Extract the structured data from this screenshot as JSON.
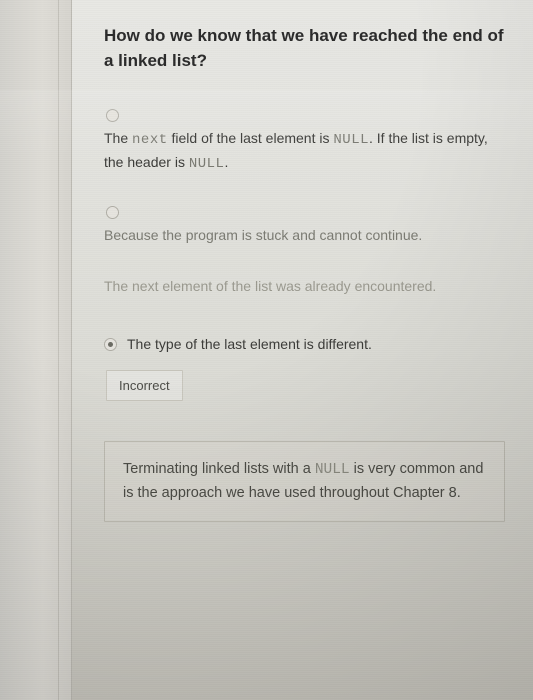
{
  "question": "How do we know that we have reached the end of a linked list?",
  "options": {
    "opt1_pre": "The ",
    "opt1_code1": "next",
    "opt1_mid": " field of the last element is ",
    "opt1_code2": "NULL",
    "opt1_post": ". If the list is empty, the header is ",
    "opt1_code3": "NULL",
    "opt1_end": ".",
    "opt2": "Because the program is stuck and cannot continue.",
    "opt3": "The next element of the list was already encountered.",
    "opt4": "The type of the last element is different."
  },
  "feedback_label": "Incorrect",
  "explanation_pre": "Terminating linked lists with a ",
  "explanation_code": "NULL",
  "explanation_post": " is very common and is the approach we have used throughout Chapter 8."
}
